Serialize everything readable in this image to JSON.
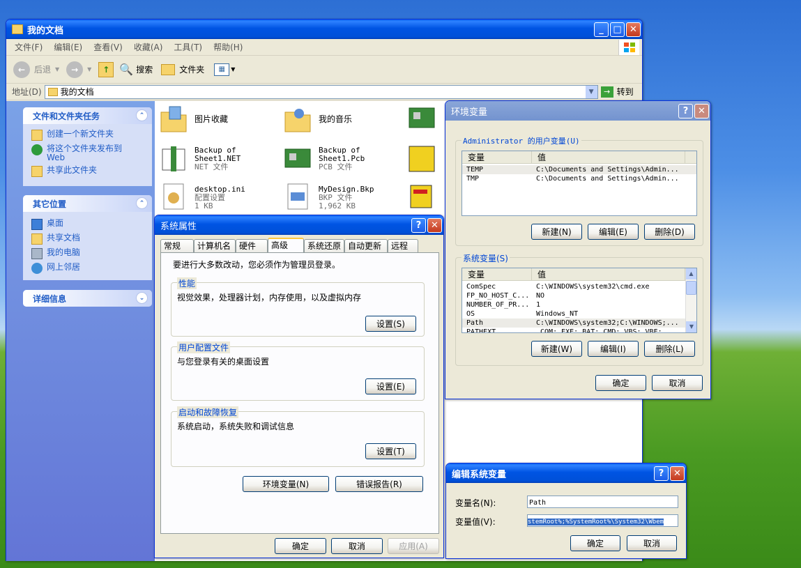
{
  "explorer": {
    "title": "我的文档",
    "menu": [
      "文件(F)",
      "编辑(E)",
      "查看(V)",
      "收藏(A)",
      "工具(T)",
      "帮助(H)"
    ],
    "toolbar": {
      "back": "后退",
      "search": "搜索",
      "folders": "文件夹"
    },
    "address": {
      "label": "地址(D)",
      "value": "我的文档",
      "go": "转到"
    },
    "tasks": {
      "title": "文件和文件夹任务",
      "items": [
        "创建一个新文件夹",
        "将这个文件夹发布到 Web",
        "共享此文件夹"
      ]
    },
    "places": {
      "title": "其它位置",
      "items": [
        "桌面",
        "共享文档",
        "我的电脑",
        "网上邻居"
      ]
    },
    "details": {
      "title": "详细信息"
    },
    "files": [
      {
        "name": "图片收藏",
        "sub": "",
        "icon": "pictures-folder-icon"
      },
      {
        "name": "我的音乐",
        "sub": "",
        "icon": "music-folder-icon"
      },
      {
        "name": "Backup of Sheet1.NET",
        "sub": "NET 文件",
        "icon": "net-file-icon"
      },
      {
        "name": "Backup of Sheet1.Pcb",
        "sub": "PCB 文件",
        "icon": "pcb-file-icon"
      },
      {
        "name": "desktop.ini",
        "sub": "配置设置",
        "sub2": "1 KB",
        "icon": "ini-file-icon"
      },
      {
        "name": "MyDesign.Bkp",
        "sub": "BKP 文件",
        "sub2": "1,962 KB",
        "icon": "bkp-file-icon"
      }
    ]
  },
  "sysprops": {
    "title": "系统属性",
    "tabs": [
      "常规",
      "计算机名",
      "硬件",
      "高级",
      "系统还原",
      "自动更新",
      "远程"
    ],
    "notice": "要进行大多数改动，您必须作为管理员登录。",
    "perf": {
      "label": "性能",
      "desc": "视觉效果，处理器计划，内存使用，以及虚拟内存",
      "btn": "设置(S)"
    },
    "profile": {
      "label": "用户配置文件",
      "desc": "与您登录有关的桌面设置",
      "btn": "设置(E)"
    },
    "startup": {
      "label": "启动和故障恢复",
      "desc": "系统启动，系统失败和调试信息",
      "btn": "设置(T)"
    },
    "envbtn": "环境变量(N)",
    "errbtn": "错误报告(R)",
    "ok": "确定",
    "cancel": "取消",
    "apply": "应用(A)"
  },
  "envvars": {
    "title": "环境变量",
    "user_label": "Administrator 的用户变量(U)",
    "col_var": "变量",
    "col_val": "值",
    "user_rows": [
      {
        "name": "TEMP",
        "value": "C:\\Documents and Settings\\Admin..."
      },
      {
        "name": "TMP",
        "value": "C:\\Documents and Settings\\Admin..."
      }
    ],
    "sys_label": "系统变量(S)",
    "sys_rows": [
      {
        "name": "ComSpec",
        "value": "C:\\WINDOWS\\system32\\cmd.exe"
      },
      {
        "name": "FP_NO_HOST_C...",
        "value": "NO"
      },
      {
        "name": "NUMBER_OF_PR...",
        "value": "1"
      },
      {
        "name": "OS",
        "value": "Windows_NT"
      },
      {
        "name": "Path",
        "value": "C:\\WINDOWS\\system32;C:\\WINDOWS;..."
      },
      {
        "name": "PATHEXT",
        "value": ".COM;.EXE;.BAT;.CMD;.VBS;.VBE;..."
      }
    ],
    "new": "新建(N)",
    "edit": "编辑(E)",
    "del": "删除(D)",
    "new2": "新建(W)",
    "edit2": "编辑(I)",
    "del2": "删除(L)",
    "ok": "确定",
    "cancel": "取消"
  },
  "editvar": {
    "title": "编辑系统变量",
    "name_label": "变量名(N):",
    "name_value": "Path",
    "val_label": "变量值(V):",
    "val_value": "stemRoot%;%SystemRoot%\\System32\\Wbem",
    "ok": "确定",
    "cancel": "取消"
  }
}
